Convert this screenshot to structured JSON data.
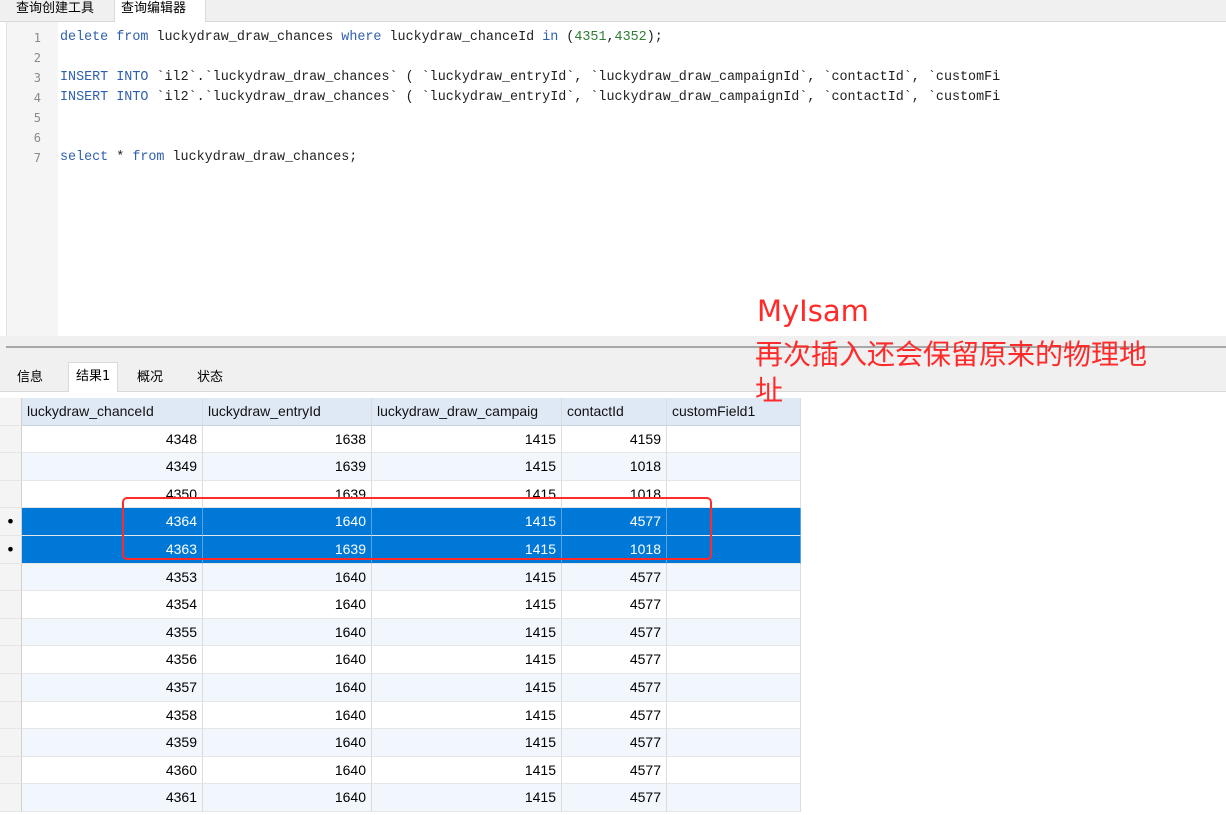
{
  "top_tabs": [
    "查询创建工具",
    "查询编辑器"
  ],
  "editor": {
    "lines": [
      {
        "no": "1",
        "tokens": [
          {
            "t": "delete",
            "c": "kw"
          },
          {
            "t": " "
          },
          {
            "t": "from",
            "c": "kw"
          },
          {
            "t": " luckydraw_draw_chances "
          },
          {
            "t": "where",
            "c": "kw"
          },
          {
            "t": " luckydraw_chanceId "
          },
          {
            "t": "in",
            "c": "kw"
          },
          {
            "t": " ("
          },
          {
            "t": "4351",
            "c": "num"
          },
          {
            "t": ","
          },
          {
            "t": "4352",
            "c": "num"
          },
          {
            "t": ");"
          }
        ]
      },
      {
        "no": "2",
        "tokens": []
      },
      {
        "no": "3",
        "tokens": [
          {
            "t": "INSERT",
            "c": "kw"
          },
          {
            "t": " "
          },
          {
            "t": "INTO",
            "c": "kw"
          },
          {
            "t": " `il2`.`luckydraw_draw_chances` ( `luckydraw_entryId`, `luckydraw_draw_campaignId`, `contactId`, `customFi"
          }
        ]
      },
      {
        "no": "4",
        "tokens": [
          {
            "t": "INSERT",
            "c": "kw"
          },
          {
            "t": " "
          },
          {
            "t": "INTO",
            "c": "kw"
          },
          {
            "t": " `il2`.`luckydraw_draw_chances` ( `luckydraw_entryId`, `luckydraw_draw_campaignId`, `contactId`, `customFi"
          }
        ]
      },
      {
        "no": "5",
        "tokens": []
      },
      {
        "no": "6",
        "tokens": []
      },
      {
        "no": "7",
        "tokens": [
          {
            "t": "select",
            "c": "kw"
          },
          {
            "t": " * "
          },
          {
            "t": "from",
            "c": "kw"
          },
          {
            "t": " luckydraw_draw_chances;"
          }
        ]
      }
    ]
  },
  "result_tabs": [
    "信息",
    "结果1",
    "概况",
    "状态"
  ],
  "grid": {
    "columns": [
      "luckydraw_chanceId",
      "luckydraw_entryId",
      "luckydraw_draw_campaig",
      "contactId",
      "customField1"
    ],
    "rows": [
      {
        "cells": [
          "4348",
          "1638",
          "1415",
          "4159",
          ""
        ],
        "selected": false,
        "marker": ""
      },
      {
        "cells": [
          "4349",
          "1639",
          "1415",
          "1018",
          ""
        ],
        "selected": false,
        "marker": ""
      },
      {
        "cells": [
          "4350",
          "1639",
          "1415",
          "1018",
          ""
        ],
        "selected": false,
        "marker": ""
      },
      {
        "cells": [
          "4364",
          "1640",
          "1415",
          "4577",
          ""
        ],
        "selected": true,
        "marker": "•"
      },
      {
        "cells": [
          "4363",
          "1639",
          "1415",
          "1018",
          ""
        ],
        "selected": true,
        "marker": "•"
      },
      {
        "cells": [
          "4353",
          "1640",
          "1415",
          "4577",
          ""
        ],
        "selected": false,
        "marker": ""
      },
      {
        "cells": [
          "4354",
          "1640",
          "1415",
          "4577",
          ""
        ],
        "selected": false,
        "marker": ""
      },
      {
        "cells": [
          "4355",
          "1640",
          "1415",
          "4577",
          ""
        ],
        "selected": false,
        "marker": ""
      },
      {
        "cells": [
          "4356",
          "1640",
          "1415",
          "4577",
          ""
        ],
        "selected": false,
        "marker": ""
      },
      {
        "cells": [
          "4357",
          "1640",
          "1415",
          "4577",
          ""
        ],
        "selected": false,
        "marker": ""
      },
      {
        "cells": [
          "4358",
          "1640",
          "1415",
          "4577",
          ""
        ],
        "selected": false,
        "marker": ""
      },
      {
        "cells": [
          "4359",
          "1640",
          "1415",
          "4577",
          ""
        ],
        "selected": false,
        "marker": ""
      },
      {
        "cells": [
          "4360",
          "1640",
          "1415",
          "4577",
          ""
        ],
        "selected": false,
        "marker": ""
      },
      {
        "cells": [
          "4361",
          "1640",
          "1415",
          "4577",
          ""
        ],
        "selected": false,
        "marker": ""
      }
    ]
  },
  "annotation": {
    "title": "MyIsam",
    "line1": "再次插入还会保留原来的物理地",
    "line2": "址",
    "color": "#ff2a2a"
  },
  "colors": {
    "selection": "#0078d7",
    "keyword": "#2f5fb0",
    "number": "#2f7d34",
    "header_bg": "#dfe9f5"
  }
}
